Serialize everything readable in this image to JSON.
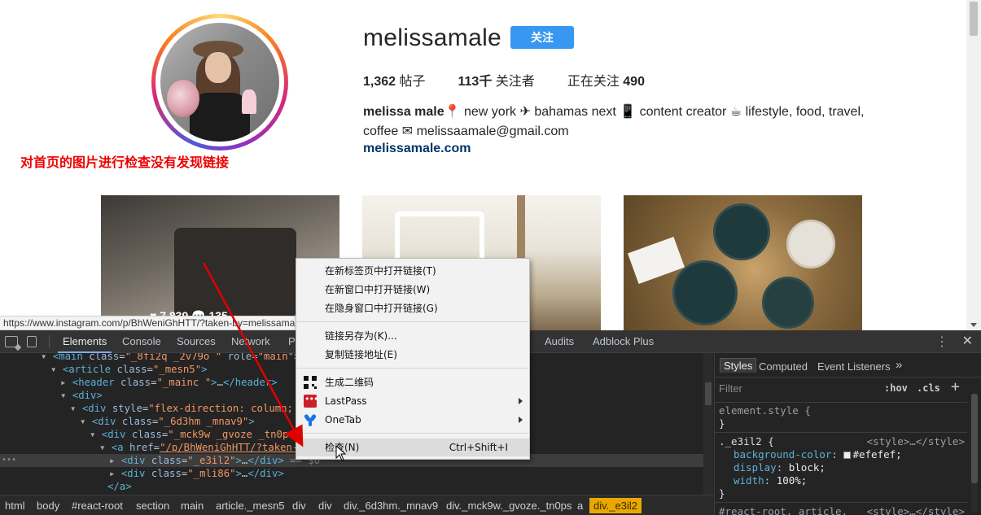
{
  "profile": {
    "username": "melissamale",
    "follow_label": "关注",
    "stats": [
      {
        "value": "1,362",
        "label": "帖子"
      },
      {
        "value": "113千",
        "label": "关注者"
      },
      {
        "label": "正在关注",
        "value": "490"
      }
    ],
    "bio_name": "melissa male",
    "bio_line1": "📍 new york ✈ bahamas next 📱 content creator ☕ lifestyle, food, travel,",
    "bio_line2": "coffee ✉ melissaamale@gmail.com",
    "link": "melissamale.com"
  },
  "annotation": "对首页的图片进行检查没有发现链接",
  "posts": [
    {
      "overlay": "♥ 7,839  💬 135"
    }
  ],
  "status_url": "https://www.instagram.com/p/BhWeniGhHTT/?taken-by=melissamale",
  "devtools": {
    "tabs": [
      "Elements",
      "Console",
      "Sources",
      "Network",
      "Pe",
      "Audits",
      "Adblock Plus"
    ],
    "active_tab": "Elements",
    "dom_lines": [
      {
        "tag_open": "<main",
        "attrs": [
          [
            "class",
            "_8fi2q _2v79o "
          ],
          [
            "role",
            "main"
          ]
        ],
        "tag_close": ">"
      },
      {
        "tag_open": "<article",
        "attrs": [
          [
            "class",
            "_mesn5"
          ]
        ],
        "tag_close": ">"
      },
      {
        "tag_open": "<header",
        "attrs": [
          [
            "class",
            "_mainc "
          ]
        ],
        "tag_close": ">…</header>"
      },
      {
        "tag_open": "<div",
        "attrs": [],
        "tag_close": ">"
      },
      {
        "tag_open": "<div",
        "attrs": [
          [
            "style",
            "flex-direction: column; p"
          ]
        ],
        "tag_close": ""
      },
      {
        "tag_open": "<div",
        "attrs": [
          [
            "class",
            "_6d3hm _mnav9"
          ]
        ],
        "tag_close": ">"
      },
      {
        "tag_open": "<div",
        "attrs": [
          [
            "class",
            "_mck9w _gvoze  _tn0ps"
          ]
        ],
        "tag_close": ""
      },
      {
        "tag_open": "<a",
        "attrs": [
          [
            "href",
            "/p/BhWeniGhHTT/?taken-b"
          ]
        ],
        "tag_close": ""
      },
      {
        "tag_open": "<div",
        "attrs": [
          [
            "class",
            "_e3il2"
          ]
        ],
        "tag_close": ">…</div>",
        "suffix": " == $0"
      },
      {
        "tag_open": "<div",
        "attrs": [
          [
            "class",
            "_mli86"
          ]
        ],
        "tag_close": ">…</div>"
      },
      {
        "tag_open": "</a>",
        "attrs": [],
        "tag_close": ""
      }
    ],
    "styles_tabs": [
      "Styles",
      "Computed",
      "Event Listeners",
      "»"
    ],
    "filter_placeholder": "Filter",
    "hov": ":hov",
    "cls": ".cls",
    "element_style": "element.style {",
    "rule_selector": "._e3il2 {",
    "rule_source": "<style>…</style>",
    "rule_props": [
      {
        "name": "background-color",
        "value": "#efefef;"
      },
      {
        "name": "display",
        "value": "block;"
      },
      {
        "name": "width",
        "value": "100%;"
      }
    ],
    "next_selector": "#react-root, article,",
    "next_source": "<style>…</style>",
    "breadcrumbs": [
      "html",
      "body",
      "#react-root",
      "section",
      "main",
      "article._mesn5",
      "div",
      "div",
      "div._6d3hm._mnav9",
      "div._mck9w._gvoze._tn0ps",
      "a",
      "div._e3il2"
    ]
  },
  "context_menu": {
    "items": [
      {
        "label": "在新标签页中打开链接(T)"
      },
      {
        "label": "在新窗口中打开链接(W)"
      },
      {
        "label": "在隐身窗口中打开链接(G)"
      },
      {
        "label": "链接另存为(K)..."
      },
      {
        "label": "复制链接地址(E)"
      },
      {
        "label": "生成二维码",
        "icon": "qr-code-icon"
      },
      {
        "label": "LastPass",
        "icon": "lastpass-icon",
        "submenu": true
      },
      {
        "label": "OneTab",
        "icon": "onetab-icon",
        "submenu": true
      },
      {
        "label": "检查(N)",
        "shortcut": "Ctrl+Shift+I"
      }
    ]
  },
  "colors": {
    "follow_button": "#3897f0",
    "annotation": "#e00000",
    "link": "#003569",
    "selected_crumb": "#e8a800"
  }
}
